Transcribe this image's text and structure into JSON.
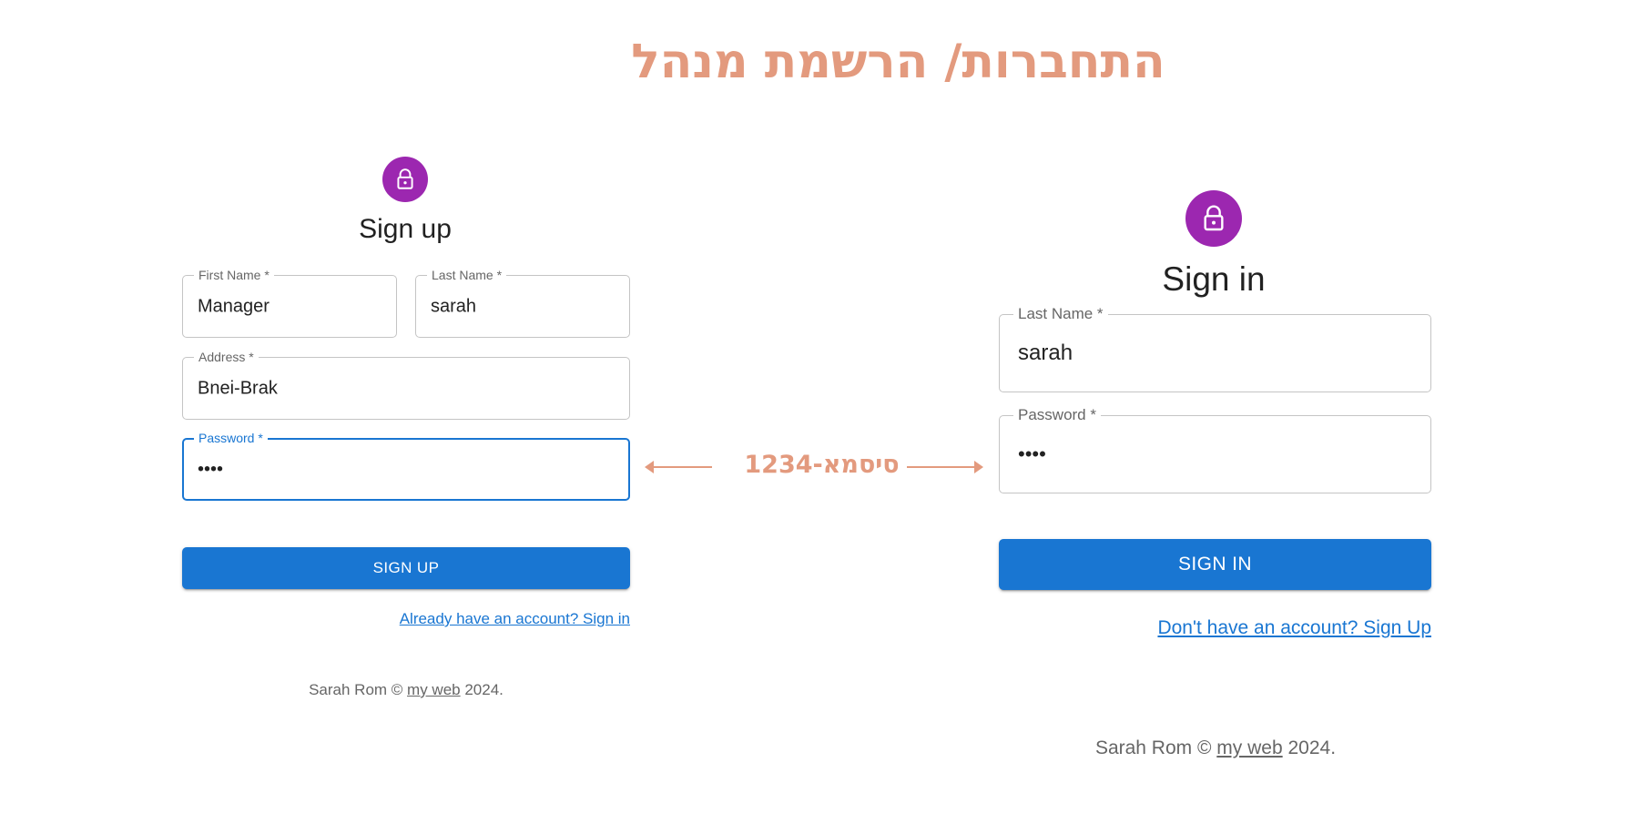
{
  "title": "התחברות/ הרשמת מנהל",
  "password_note": "סיסמא-1234",
  "colors": {
    "accent": "#e39a7e",
    "primary": "#1976d2",
    "avatar": "#9c27b0"
  },
  "signup": {
    "icon": "lock-icon",
    "heading": "Sign up",
    "first_name": {
      "label": "First Name *",
      "value": "Manager"
    },
    "last_name": {
      "label": "Last Name *",
      "value": "sarah"
    },
    "address": {
      "label": "Address *",
      "value": "Bnei-Brak"
    },
    "password": {
      "label": "Password *",
      "value": "••••"
    },
    "button": "SIGN UP",
    "link": "Already have an account? Sign in",
    "footer": {
      "prefix": "Sarah Rom © ",
      "link": "my web",
      "suffix": " 2024."
    }
  },
  "signin": {
    "icon": "lock-icon",
    "heading": "Sign in",
    "last_name": {
      "label": "Last Name *",
      "value": "sarah"
    },
    "password": {
      "label": "Password *",
      "value": "••••"
    },
    "button": "SIGN IN",
    "link": "Don't have an account? Sign Up",
    "footer": {
      "prefix": "Sarah Rom © ",
      "link": "my web",
      "suffix": " 2024."
    }
  }
}
